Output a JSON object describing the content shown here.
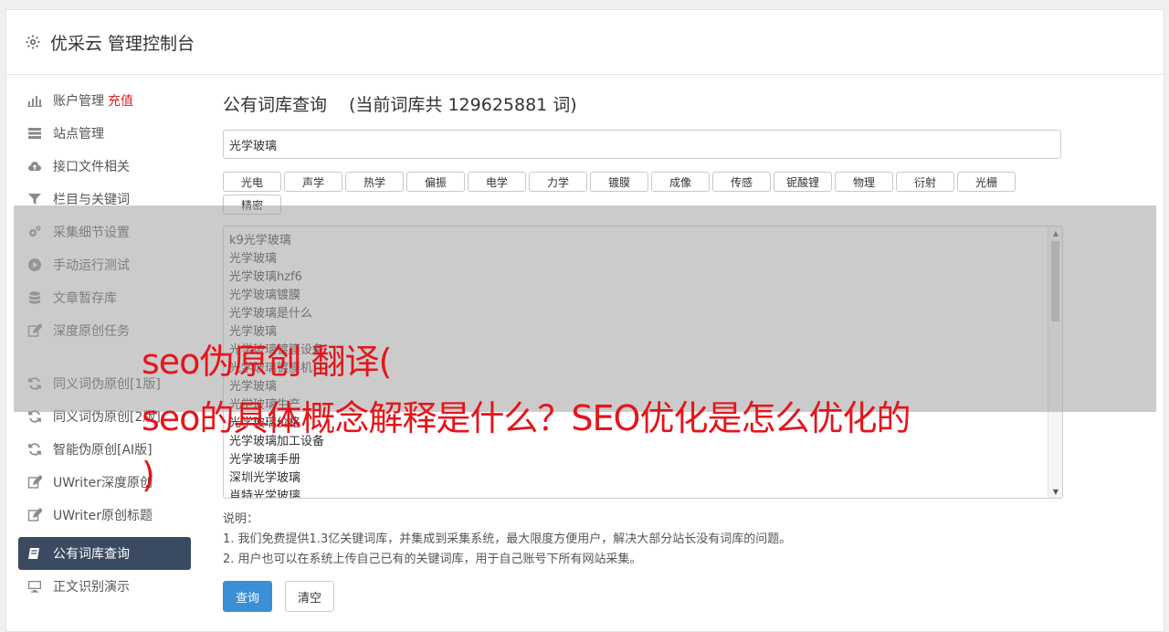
{
  "header": {
    "title": "优采云 管理控制台"
  },
  "sidebar": {
    "items": [
      {
        "label": "账户管理",
        "badge": "充值",
        "icon": "bar-chart-icon"
      },
      {
        "label": "站点管理",
        "icon": "server-icon"
      },
      {
        "label": "接口文件相关",
        "icon": "cloud-upload-icon"
      },
      {
        "label": "栏目与关键词",
        "icon": "filter-icon"
      },
      {
        "label": "采集细节设置",
        "icon": "cogs-icon"
      },
      {
        "label": "手动运行测试",
        "icon": "play-circle-icon"
      },
      {
        "label": "文章暂存库",
        "icon": "database-icon"
      },
      {
        "label": "深度原创任务",
        "icon": "edit-icon"
      }
    ],
    "items2": [
      {
        "label": "同义词伪原创[1版]",
        "icon": "refresh-icon"
      },
      {
        "label": "同义词伪原创[2版]",
        "icon": "refresh-icon"
      },
      {
        "label": "智能伪原创[AI版]",
        "icon": "refresh-icon"
      },
      {
        "label": "UWriter深度原创",
        "icon": "edit-icon"
      },
      {
        "label": "UWriter原创标题",
        "icon": "edit-icon"
      }
    ],
    "active": {
      "label": "公有词库查询",
      "icon": "book-icon"
    },
    "items3": [
      {
        "label": "正文识别演示",
        "icon": "monitor-icon"
      }
    ]
  },
  "main": {
    "title": "公有词库查询",
    "count_text": "(当前词库共 129625881 词)",
    "input_value": "光学玻璃",
    "tags": [
      "光电",
      "声学",
      "热学",
      "偏振",
      "电学",
      "力学",
      "镀膜",
      "成像",
      "传感",
      "铌酸锂",
      "物理",
      "衍射",
      "光栅",
      "精密"
    ],
    "results": [
      "k9光学玻璃",
      "光学玻璃",
      "光学玻璃hzf6",
      "光学玻璃镀膜",
      "光学玻璃是什么",
      "光学玻璃",
      "光学玻璃镀膜设备",
      "光学玻璃镀膜机",
      "光学玻璃",
      "光学玻璃生产",
      "光学玻璃价格",
      "光学玻璃加工设备",
      "光学玻璃手册",
      "深圳光学玻璃",
      "肖特光学玻璃"
    ],
    "notes_title": "说明：",
    "notes": [
      "1. 我们免费提供1.3亿关键词库，并集成到采集系统，最大限度方便用户，解决大部分站长没有词库的问题。",
      "2. 用户也可以在系统上传自己已有的关键词库，用于自己账号下所有网站采集。"
    ],
    "query_button": "查询",
    "clear_button": "清空"
  },
  "overlay": {
    "line1": "seo伪原创 翻译(",
    "line2": "seo的具体概念解释是什么？SEO优化是怎么优化的",
    "line3": ")"
  },
  "colors": {
    "accent": "#3b8fd6",
    "active_nav": "#3a4a60",
    "overlay_text": "#e6141b",
    "badge": "#e02020"
  }
}
